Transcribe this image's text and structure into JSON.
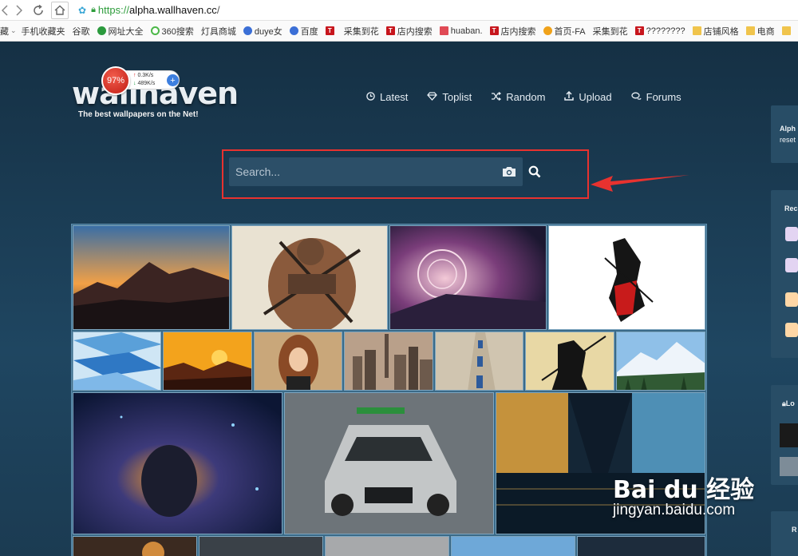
{
  "browser": {
    "url_scheme": "https://",
    "url_host": "alpha.wallhaven.cc",
    "url_path": "/"
  },
  "bookmarks": {
    "first_label": "藏",
    "items": [
      {
        "label": "手机收藏夹",
        "icon": "page-icon"
      },
      {
        "label": "谷歌",
        "icon": "page-icon"
      },
      {
        "label": "网址大全",
        "icon": "green-globe-icon"
      },
      {
        "label": "360搜索",
        "icon": "green-globe-icon"
      },
      {
        "label": "灯具商城",
        "icon": "page-icon"
      },
      {
        "label": "duye女",
        "icon": "paw-icon"
      },
      {
        "label": "百度",
        "icon": "paw-icon"
      },
      {
        "label": "",
        "icon": "red-t-icon"
      },
      {
        "label": "采集到花",
        "icon": "page-icon"
      },
      {
        "label": "店内搜索",
        "icon": "red-t-icon"
      },
      {
        "label": "huaban.",
        "icon": "pink-icon"
      },
      {
        "label": "店内搜索",
        "icon": "red-t-icon"
      },
      {
        "label": "首页-FA",
        "icon": "orange-icon"
      },
      {
        "label": "采集到花",
        "icon": "page-icon"
      },
      {
        "label": "????????",
        "icon": "red-t-icon"
      },
      {
        "label": "店铺风格",
        "icon": "folder-icon"
      },
      {
        "label": "电商",
        "icon": "folder-icon"
      }
    ]
  },
  "speed_widget": {
    "percent": "97%",
    "upload": "0.3K/s",
    "download": "489K/s",
    "plus": "+"
  },
  "site": {
    "logo": "wallhaven",
    "tagline": "The best wallpapers on the Net!"
  },
  "nav": [
    {
      "label": "Latest",
      "icon": "clock-icon"
    },
    {
      "label": "Toplist",
      "icon": "diamond-icon"
    },
    {
      "label": "Random",
      "icon": "shuffle-icon"
    },
    {
      "label": "Upload",
      "icon": "upload-icon"
    },
    {
      "label": "Forums",
      "icon": "chat-icon"
    }
  ],
  "search": {
    "placeholder": "Search..."
  },
  "sidebar": {
    "user_name": "Alph",
    "user_sub": "reset",
    "recent_label": "Rec",
    "login_label": "Lo",
    "bottom_label": "R"
  },
  "watermark": {
    "brand": "Bai du 经验",
    "url": "jingyan.baidu.com"
  },
  "colors": {
    "page_bg": "#1d3a4e",
    "highlight_red": "#e8322f",
    "search_bg": "#2c4f68"
  }
}
